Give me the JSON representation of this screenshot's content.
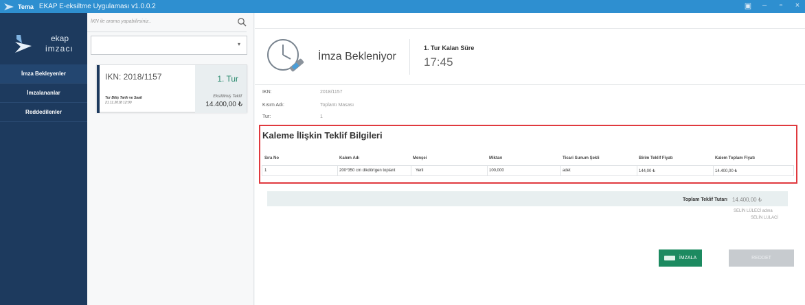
{
  "titlebar": {
    "menu": "Tema",
    "title": "EKAP E-eksiltme Uygulaması v1.0.0.2",
    "controls": [
      "▣",
      "–",
      "▫",
      "×"
    ]
  },
  "logo": {
    "line1": "ekap",
    "line2": "imzacı"
  },
  "sidebar": {
    "items": [
      {
        "label": "İmza Bekleyenler"
      },
      {
        "label": "İmzalananlar"
      },
      {
        "label": "Reddedilenler"
      }
    ]
  },
  "list": {
    "search_placeholder": "İKN ile arama yapabilirsiniz..",
    "card": {
      "ikn": "IKN: 2018/1157",
      "tur": "1. Tur",
      "date_label": "Tur Bitiş Tarih ve Saati",
      "date_value": "21.11.2018 12:00",
      "offer_label": "Eksiltilmiş Teklif",
      "offer_value": "14.400,00 ₺"
    }
  },
  "main": {
    "status": "İmza Bekleniyor",
    "tur_label": "1. Tur Kalan Süre",
    "time": "17:45",
    "info": [
      {
        "label": "IKN:",
        "value": "2018/1157"
      },
      {
        "label": "Kısım Adı:",
        "value": "Toplantı Masası"
      },
      {
        "label": "Tur:",
        "value": "1"
      }
    ],
    "section_title": "Kaleme İlişkin Teklif Bilgileri",
    "table": {
      "headers": [
        "Sıra No",
        "Kalem Adı",
        "Menşei",
        "Miktarı",
        "Ticari Sunum Şekli",
        "Birim Teklif Fiyatı",
        "Kalem Toplam Fiyatı"
      ],
      "rows": [
        [
          "1",
          "200*350 cm dikdörtgen toplant",
          "Yerli",
          "100,000",
          "adet",
          "144,00 ₺",
          "14.400,00 ₺"
        ]
      ]
    },
    "total_label": "Toplam Teklif Tutarı",
    "total_value": "14.400,00 ₺",
    "signer_line1": "SELİN LÜLECİ adına",
    "signer_line2": "SELİN LULACİ",
    "sign_button": "İMZALA",
    "reject_button": "REDDET"
  }
}
